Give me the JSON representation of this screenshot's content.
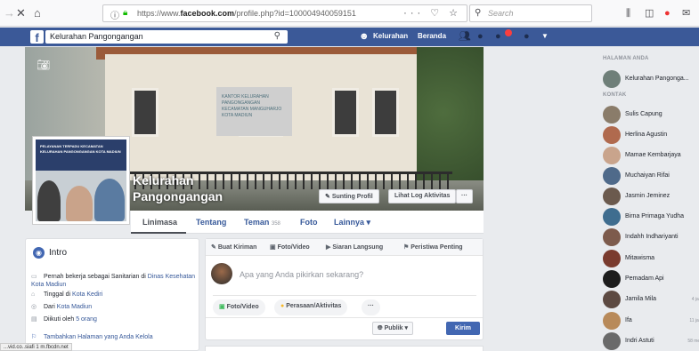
{
  "browser": {
    "url_prefix": "https://www.",
    "url_domain": "facebook.com",
    "url_suffix": "/profile.php?id=100004940059151",
    "search_placeholder": "Search",
    "url_dots": "···"
  },
  "header": {
    "logo": "f",
    "search_value": "Kelurahan Pangongangan",
    "profile_link": "Kelurahan",
    "home_link": "Beranda"
  },
  "cover": {
    "name_line1": "Kelurahan",
    "name_line2": "Pangongangan",
    "sign_text": "KANTOR KELURAHAN PANGONGANGAN KECAMATAN MANGUHARJO KOTA MADIUN",
    "edit_profile": "Sunting Profil",
    "activity_log": "Lihat Log Aktivitas",
    "more": "···"
  },
  "profile_pic": {
    "banner_text": "PELAYANAN TERPADU KECAMATAN KELURAHAN PANGONGANGAN KOTA MADIUN"
  },
  "tabs": [
    {
      "label": "Linimasa"
    },
    {
      "label": "Tentang"
    },
    {
      "label": "Teman",
      "count": "358"
    },
    {
      "label": "Foto"
    },
    {
      "label": "Lainnya ▾"
    }
  ],
  "intro": {
    "title": "Intro",
    "work_prefix": "Pernah bekerja sebagai Sanitarian di ",
    "work_link": "Dinas Kesehatan Kota Madiun",
    "lives_prefix": "Tinggal di ",
    "lives_link": "Kota Kediri",
    "from_prefix": "Dari ",
    "from_link": "Kota Madiun",
    "followed_prefix": "Diikuti oleh ",
    "followed_link": "5 orang",
    "add_pages": "Tambahkan Halaman yang Anda Kelola"
  },
  "composer": {
    "tabs": [
      "Buat Kiriman",
      "Foto/Video",
      "Siaran Langsung",
      "Peristiwa Penting"
    ],
    "prompt": "Apa yang Anda pikirkan sekarang?",
    "chip_photo": "Foto/Video",
    "chip_feeling": "Perasaan/Aktivitas",
    "chip_more": "···",
    "privacy": "Publik ▾",
    "submit": "Kirim"
  },
  "status_bar": "...vid.co..siafi 1 m.fbcdn.net",
  "sidebar": {
    "pages_header": "HALAMAN ANDA",
    "page_name": "Kelurahan Pangonga...",
    "contacts_header": "KONTAK",
    "contacts": [
      {
        "name": "Sulis Capung",
        "time": ""
      },
      {
        "name": "Herlina Agustin",
        "time": ""
      },
      {
        "name": "Mamae Kembarjaya",
        "time": ""
      },
      {
        "name": "Muchaiyan Rifai",
        "time": ""
      },
      {
        "name": "Jasmin Jeminez",
        "time": ""
      },
      {
        "name": "Birna Primaga Yudha",
        "time": ""
      },
      {
        "name": "Indahh Indhariyanti",
        "time": ""
      },
      {
        "name": "Mitawisma",
        "time": "1"
      },
      {
        "name": "Pemadam Api",
        "time": ""
      },
      {
        "name": "Jamila Mila",
        "time": "4 jam"
      },
      {
        "name": "Ifa",
        "time": "11 jam"
      },
      {
        "name": "Indri Astuti",
        "time": "58 men"
      }
    ]
  },
  "colors": {
    "fb_blue": "#3b5998",
    "button_blue": "#4267b2",
    "link": "#365899"
  }
}
